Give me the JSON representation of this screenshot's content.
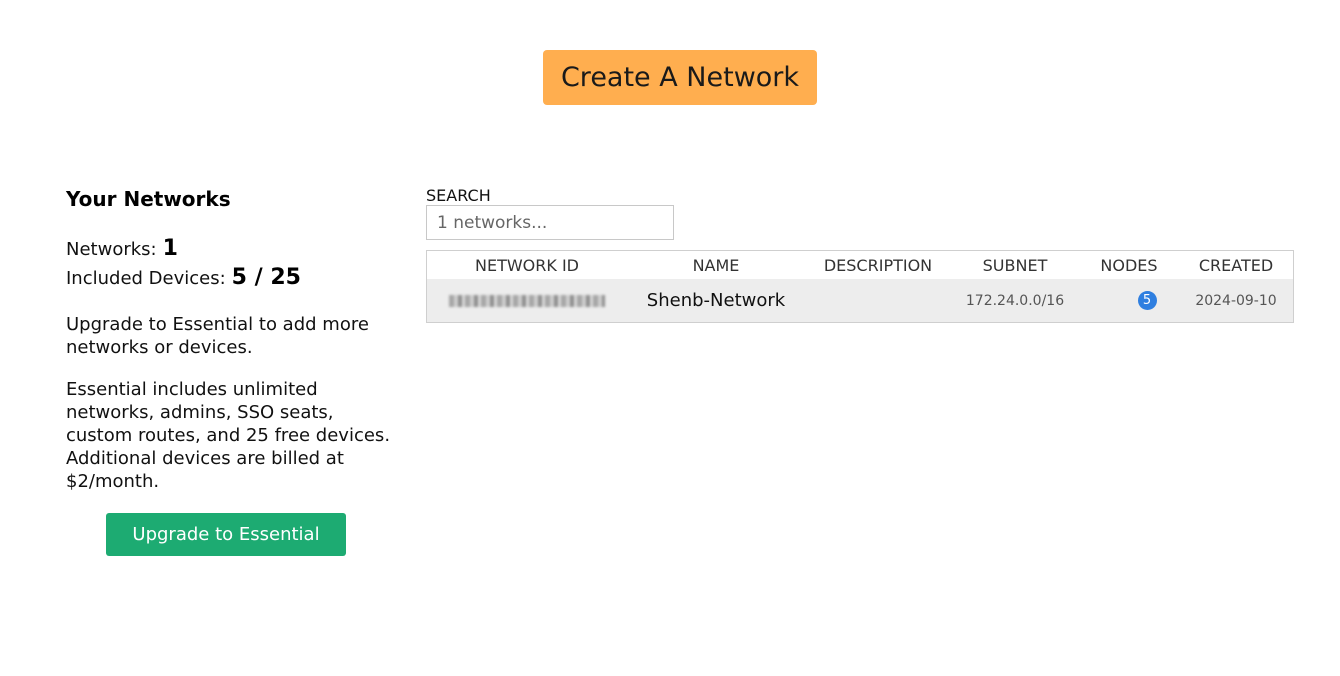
{
  "header": {
    "create_button_label": "Create A Network"
  },
  "sidebar": {
    "title": "Your Networks",
    "networks_label": "Networks:",
    "networks_count": "1",
    "devices_label": "Included Devices:",
    "devices_count": "5 / 25",
    "upgrade_text": "Upgrade to Essential to add more networks or devices.",
    "essential_text": "Essential includes unlimited networks, admins, SSO seats, custom routes, and 25 free devices. Additional devices are billed at $2/month.",
    "upgrade_button_label": "Upgrade to Essential"
  },
  "search": {
    "label": "SEARCH",
    "placeholder": "1 networks..."
  },
  "table": {
    "columns": [
      "NETWORK ID",
      "NAME",
      "DESCRIPTION",
      "SUBNET",
      "NODES",
      "CREATED"
    ],
    "rows": [
      {
        "network_id": "",
        "name": "Shenb-Network",
        "description": "",
        "subnet": "172.24.0.0/16",
        "nodes": "5",
        "created": "2024-09-10"
      }
    ]
  },
  "colors": {
    "create_button": "#ffae4f",
    "upgrade_button": "#1dab72",
    "node_badge": "#2f7fe0",
    "row_background": "#ededed"
  }
}
